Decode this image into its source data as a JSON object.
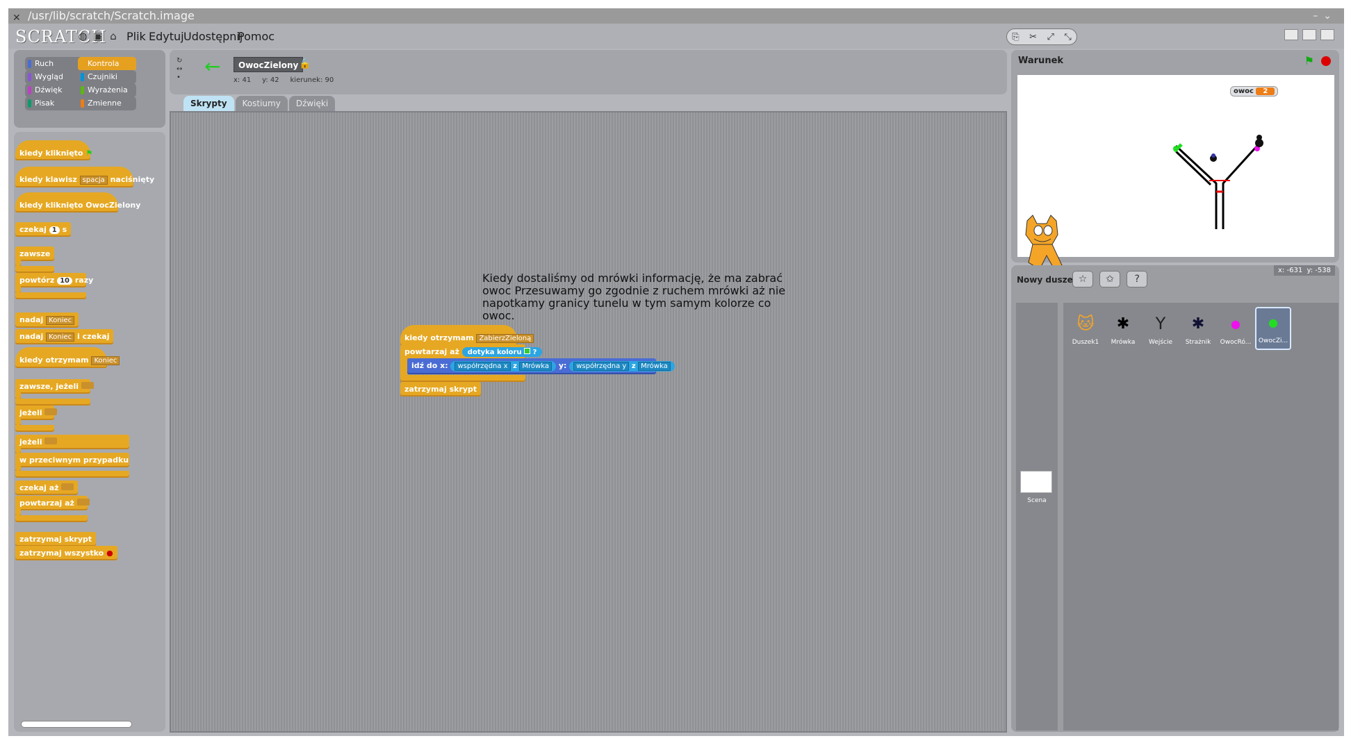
{
  "window": {
    "title": "/usr/lib/scratch/Scratch.image"
  },
  "menu": {
    "logo": "SCRATCH",
    "items": [
      "Plik",
      "Edytuj",
      "Udostępnij",
      "Pomoc"
    ]
  },
  "categories": [
    {
      "label": "Ruch",
      "color": "#4a6cd4"
    },
    {
      "label": "Kontrola",
      "color": "#e6a020",
      "active": true
    },
    {
      "label": "Wygląd",
      "color": "#8a55d7"
    },
    {
      "label": "Czujniki",
      "color": "#0094dd"
    },
    {
      "label": "Dźwięk",
      "color": "#bb42c3"
    },
    {
      "label": "Wyrażenia",
      "color": "#5cb712"
    },
    {
      "label": "Pisak",
      "color": "#0e9a6c"
    },
    {
      "label": "Zmienne",
      "color": "#ee7d16"
    }
  ],
  "palette": {
    "when_flag": "kiedy kliknięto",
    "when_key_pre": "kiedy klawisz",
    "when_key_key": "spacja",
    "when_key_post": "naciśnięty",
    "when_clicked": "kiedy kliknięto OwocZielony",
    "wait_pre": "czekaj",
    "wait_val": "1",
    "wait_post": "s",
    "forever": "zawsze",
    "repeat_pre": "powtórz",
    "repeat_val": "10",
    "repeat_post": "razy",
    "broadcast": "nadaj",
    "broadcast_msg": "Koniec",
    "broadcast_wait_pre": "nadaj",
    "broadcast_wait_msg": "Koniec",
    "broadcast_wait_post": "i czekaj",
    "when_receive": "kiedy otrzymam",
    "when_receive_msg": "Koniec",
    "forever_if": "zawsze, jeżeli",
    "if": "jeżeli",
    "if_else": "jeżeli",
    "else": "w przeciwnym przypadku",
    "wait_until": "czekaj aż",
    "repeat_until": "powtarzaj aż",
    "stop_script": "zatrzymaj skrypt",
    "stop_all": "zatrzymaj wszystko"
  },
  "sprite": {
    "name": "OwocZielony",
    "x_label": "x:",
    "x": "41",
    "y_label": "y:",
    "y": "42",
    "dir_label": "kierunek:",
    "dir": "90"
  },
  "tabs": [
    "Skrypty",
    "Kostiumy",
    "Dźwięki"
  ],
  "script": {
    "hat": "kiedy otrzymam",
    "hat_msg": "ZabierzZieloną",
    "loop": "powtarzaj aż",
    "touch": "dotyka koloru",
    "q": "?",
    "goto": "idź do x:",
    "xpos": "współrzędna x",
    "of1": "z",
    "obj1": "Mrówka",
    "y_lbl": "y:",
    "ypos": "współrzędna y",
    "of2": "z",
    "obj2": "Mrówka",
    "stop": "zatrzymaj skrypt"
  },
  "note": "Kiedy dostaliśmy od mrówki informację, że ma zabrać owoc Przesuwamy go zgodnie z ruchem mrówki aż nie napotkamy granicy tunelu w tym samym kolorze co owoc.",
  "stage": {
    "title": "Warunek",
    "var_name": "owoc",
    "var_value": "2"
  },
  "coords": {
    "x_label": "x:",
    "x": "-631",
    "y_label": "y:",
    "y": "-538"
  },
  "new_sprite_label": "Nowy duszek:",
  "sprites": [
    "Duszek1",
    "Mrówka",
    "Wejście",
    "Strażnik",
    "OwocRó...",
    "OwocZi..."
  ],
  "stage_thumb": "Scena"
}
